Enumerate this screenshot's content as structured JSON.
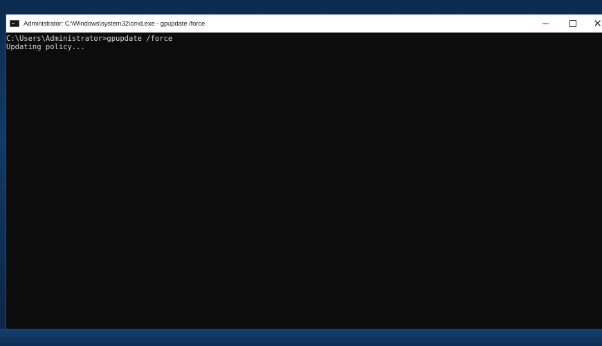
{
  "window": {
    "title": "Administrator: C:\\Windows\\system32\\cmd.exe - gpupdate /force",
    "controls": {
      "minimize_icon": "minimize-icon",
      "maximize_icon": "maximize-icon",
      "close_label": "✕"
    }
  },
  "console": {
    "lines": [
      "C:\\Users\\Administrator>gpupdate /force",
      "Updating policy..."
    ]
  },
  "colors": {
    "console_bg": "#0c0c0c",
    "console_text": "#d4d4d4",
    "titlebar_bg": "#ffffff",
    "desktop_bg": "#0f2a4a"
  }
}
